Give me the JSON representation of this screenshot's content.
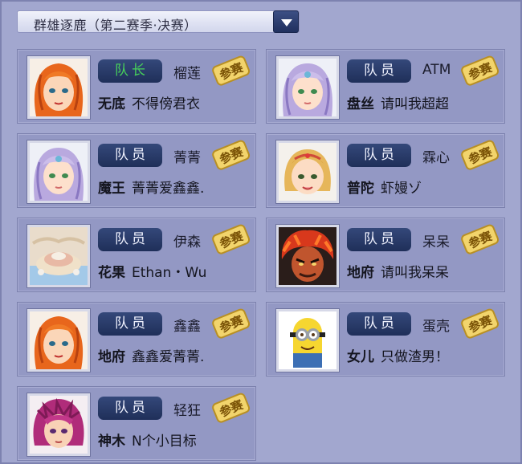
{
  "dropdown": {
    "label": "群雄逐鹿（第二赛季·决赛）",
    "arrow_icon": "chevron-down-icon"
  },
  "badge_text": "参赛",
  "colors": {
    "background": "#9da3cc",
    "card": "#9398c4",
    "role_pill": "#27396a",
    "captain_text": "#47d25a",
    "badge": "#f2d46c"
  },
  "members": [
    {
      "role": "队长",
      "nick": "榴莲",
      "server": "无底",
      "name": "不得傍君衣",
      "avatar": "orange-hair-avatar"
    },
    {
      "role": "队员",
      "nick": "ATM",
      "server": "盘丝",
      "name": "请叫我超超",
      "avatar": "purple-hair-avatar"
    },
    {
      "role": "队员",
      "nick": "菁菁",
      "server": "魔王",
      "name": "菁菁爱鑫鑫.",
      "avatar": "purple-hair-avatar"
    },
    {
      "role": "队员",
      "nick": "霖心",
      "server": "普陀",
      "name": "虾嫚ゾ",
      "avatar": "blonde-tiara-avatar"
    },
    {
      "role": "队员",
      "nick": "伊森",
      "server": "花果",
      "name": "Ethan・Wu",
      "avatar": "landscape-avatar"
    },
    {
      "role": "队员",
      "nick": "呆呆",
      "server": "地府",
      "name": "请叫我呆呆",
      "avatar": "red-demon-avatar"
    },
    {
      "role": "队员",
      "nick": "鑫鑫",
      "server": "地府",
      "name": "鑫鑫爱菁菁.",
      "avatar": "orange-hair-avatar"
    },
    {
      "role": "队员",
      "nick": "蛋壳",
      "server": "女儿",
      "name": "只做渣男！",
      "avatar": "minion-avatar"
    },
    {
      "role": "队员",
      "nick": "轻狂",
      "server": "神木",
      "name": "N个小目标",
      "avatar": "magenta-hair-avatar"
    }
  ]
}
